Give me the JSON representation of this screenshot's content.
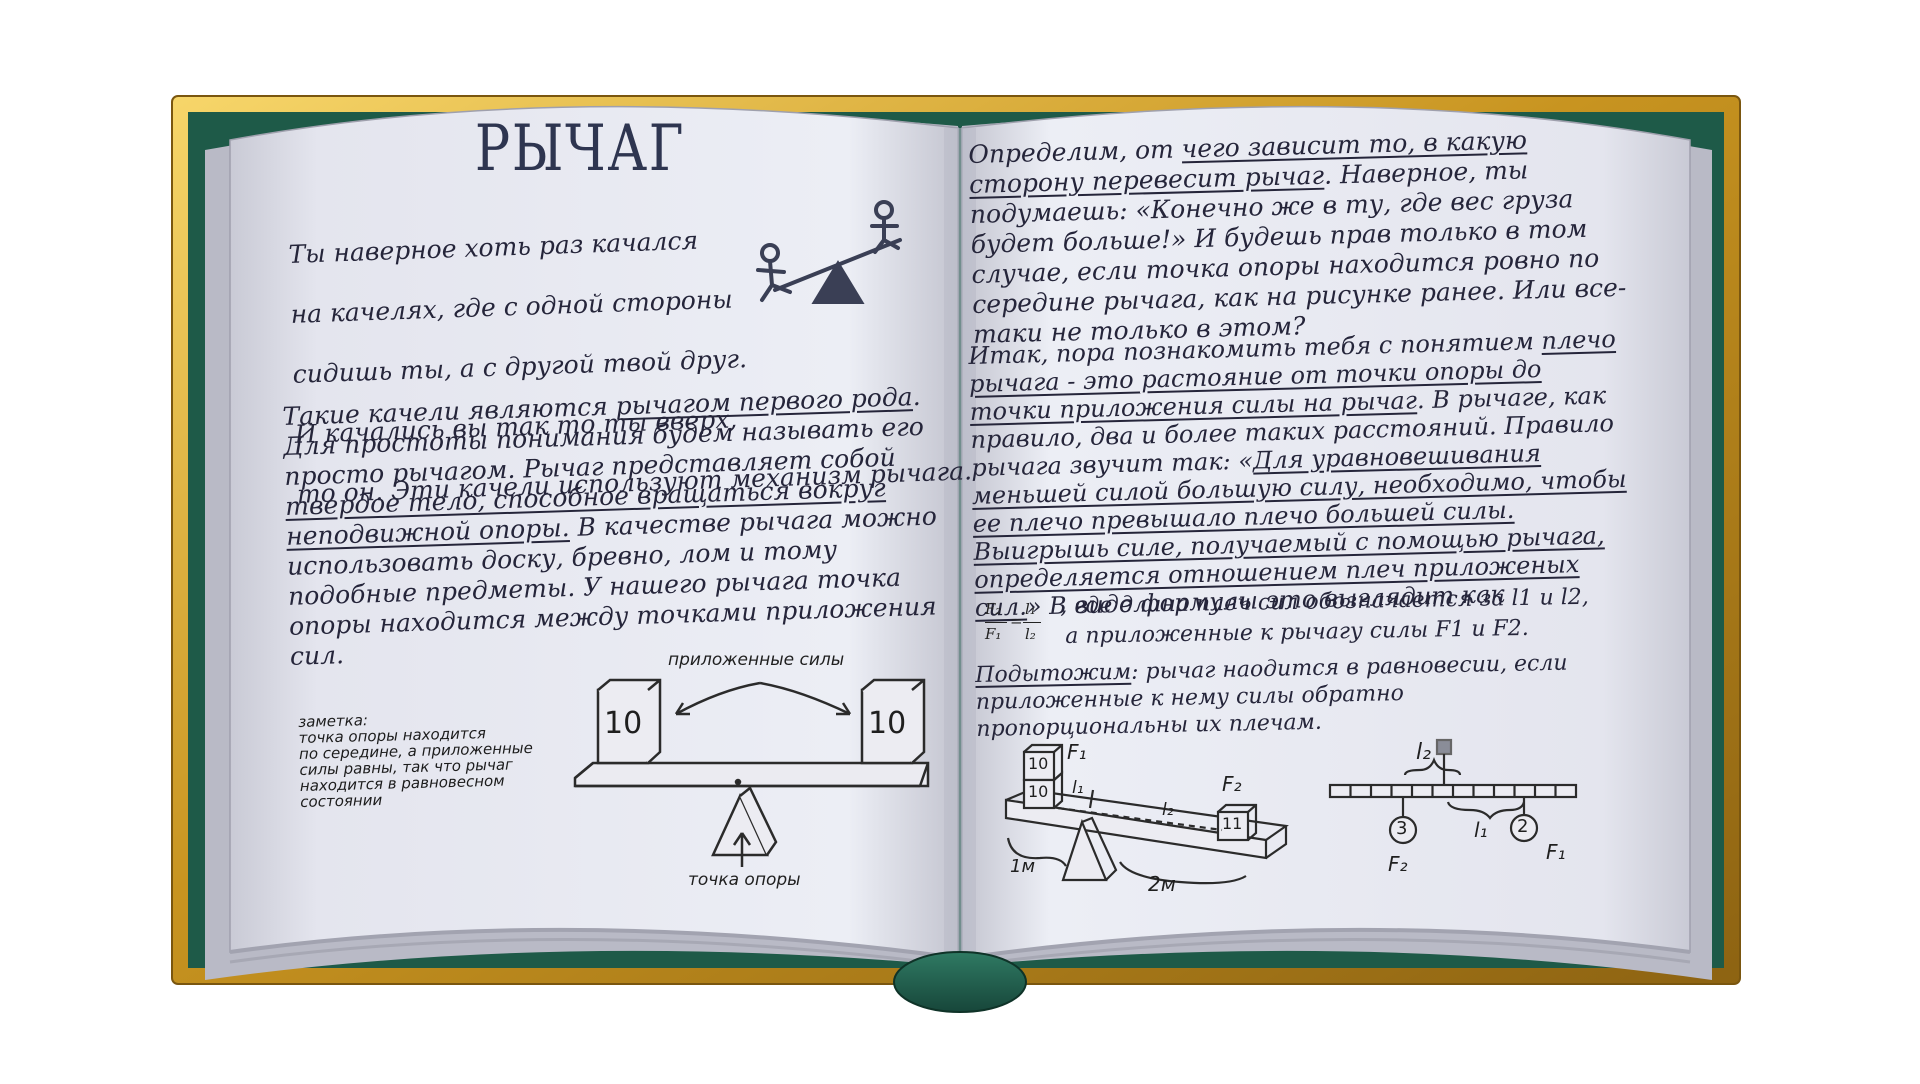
{
  "left_page": {
    "title": "РЫЧАГ",
    "intro_lines": [
      "Ты наверное хоть раз качался",
      "на качелях, где с одной стороны",
      "сидишь ты, а с другой твой друг.",
      "И качались вы так то ты вверх,",
      "то он. Эти качели используют механизм рычага."
    ],
    "p2": {
      "t1": "Такие качели являются ",
      "u1": "рычагом первого рода",
      "t2": ". Для простоты понимания будем называть его просто рычагом. Рычаг представляет собой ",
      "u2": "твердое тело, способное вращаться вокруг неподвижной опоры.",
      "t3": " В качестве рычага можно использовать доску, бревно, лом и тому подобные предметы. У нашего рычага точка опоры находится между точками приложения сил."
    },
    "note": "заметка:\nточка опоры находится\nпо середине, а приложенные\nсилы равны, так что рычаг\nнаходится в равновесном\nсостоянии",
    "figure": {
      "forces_label": "приложенные силы",
      "fulcrum_label": "точка опоры",
      "weight_left": "10",
      "weight_right": "10"
    }
  },
  "right_page": {
    "p1": {
      "t1": "Определим, от ",
      "u1": "чего зависит то, в какую сторону перевесит рычаг",
      "t2": ". Наверное, ты подумаешь: «Конечно  же в ту, где вес груза будет больше!» И будешь прав только в том случае, если точка опоры находится ровно по середине рычага, как на рисунке ранее. Или все-таки не только в этом?"
    },
    "p2": {
      "t1": "Итак, пора познакомить тебя с понятием ",
      "u1": "плечо рычага - это растояние от точки опоры до точки приложения силы на рычаг",
      "t2": ". В рычаге, как правило, два и более таких расстояний. Правило рычага звучит так: «",
      "u2": "Для уравновешивания меньшей силой большую силу, необходимо, чтобы ее плечо превышало плечо большей силы. Выигрышь силе, получаемый с помощью рычага, определяется отношением плеч приложеных сил.",
      "t3": "» В виде формулы это выглядит как"
    },
    "formula": {
      "f_num": "F₂",
      "f_den": "F₁",
      "eq": "=",
      "l_num": "l₁",
      "l_den": "l₂",
      "line1": ", где длина плеч сил обозначается за l1 и l2,",
      "line2": "а приложенные к рычагу силы F1 и  F2."
    },
    "summary": {
      "u1": "Подытожим",
      "t1": ": рычаг наодится в равновесии, если приложенные к нему силы обратно пропорциональны их плечам."
    },
    "fig1": {
      "w1": "10",
      "w2": "10",
      "w3": "11",
      "F1": "F₁",
      "F2": "F₂",
      "l1": "l₁",
      "l2": "l₂",
      "d1": "1м",
      "d2": "2м"
    },
    "fig2": {
      "l2": "l₂",
      "l1": "l₁",
      "c3": "3",
      "c2": "2",
      "F2": "F₂",
      "F1": "F₁"
    }
  },
  "colors": {
    "cover": "#1e5a48",
    "gold": "#d4a72c",
    "page": "#e6e7ef",
    "ink": "#25253a"
  }
}
